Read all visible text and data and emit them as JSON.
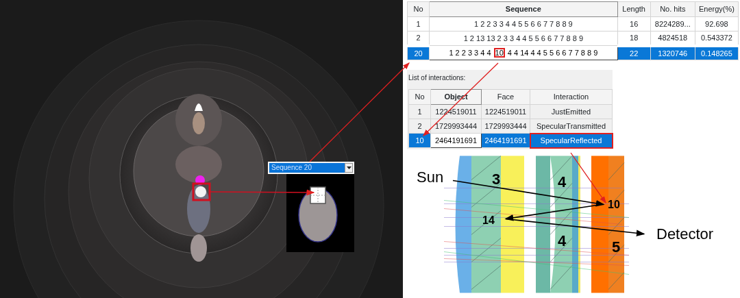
{
  "flare_view": {
    "sequence_dropdown": {
      "value": "Sequence 20"
    }
  },
  "sequences": {
    "columns": [
      {
        "label": "No",
        "sorted": false
      },
      {
        "label": "Sequence",
        "sorted": true
      },
      {
        "label": "Length",
        "sorted": false
      },
      {
        "label": "No. hits",
        "sorted": false
      },
      {
        "label": "Energy(%)",
        "sorted": false
      }
    ],
    "rows": [
      {
        "selected": false,
        "cells": [
          {
            "text": "1"
          },
          {
            "text": "1 2 2 3 3 4 4 5 5 6 6 7 7 8 8 9"
          },
          {
            "text": "16"
          },
          {
            "text": "8224289..."
          },
          {
            "text": "92.698"
          }
        ]
      },
      {
        "selected": false,
        "cells": [
          {
            "text": "2"
          },
          {
            "text": "1 2 13 13 2 3 3 4 4 5 5 6 6 7 7 8 8 9"
          },
          {
            "text": "18"
          },
          {
            "text": "4824518"
          },
          {
            "text": "0.543372"
          }
        ]
      },
      {
        "selected": true,
        "cells": [
          {
            "text": "20",
            "focused": false
          },
          {
            "parts": [
              {
                "text": "1 2 2 3 3 4 4",
                "boxed": false
              },
              {
                "text": "10",
                "boxed": true
              },
              {
                "text": "4 4 14 4 4 5 5 6 6 7 7 8 8 9",
                "boxed": false
              }
            ],
            "focused": true
          },
          {
            "text": "22",
            "focused": false
          },
          {
            "text": "1320746",
            "focused": false
          },
          {
            "text": "0.148265",
            "focused": false
          }
        ]
      }
    ]
  },
  "interactions": {
    "title": "List of interactions:",
    "columns": [
      {
        "label": "No",
        "sorted": false
      },
      {
        "label": "Object",
        "sorted": true
      },
      {
        "label": "Face",
        "sorted": false
      },
      {
        "label": "Interaction",
        "sorted": false
      }
    ],
    "rows": [
      {
        "selected": false,
        "cells": [
          {
            "text": "1"
          },
          {
            "text": "1224519011"
          },
          {
            "text": "1224519011"
          },
          {
            "text": "JustEmitted"
          }
        ]
      },
      {
        "selected": false,
        "cells": [
          {
            "text": "2"
          },
          {
            "text": "1729993444"
          },
          {
            "text": "1729993444"
          },
          {
            "text": "SpecularTransmitted"
          }
        ]
      },
      {
        "selected": true,
        "cells": [
          {
            "text": "10",
            "focused": false,
            "boxed": false
          },
          {
            "text": "2464191691",
            "focused": true,
            "boxed": false
          },
          {
            "text": "2464191691",
            "focused": false,
            "boxed": false
          },
          {
            "text": "SpecularReflected",
            "focused": false,
            "boxed": true
          }
        ]
      }
    ]
  },
  "lens_diagram": {
    "labels": [
      {
        "kind": "plain",
        "text": "Sun"
      },
      {
        "kind": "bold",
        "text": "3"
      },
      {
        "kind": "bold",
        "text": "4"
      },
      {
        "kind": "bold",
        "text": "10"
      },
      {
        "kind": "bold",
        "text": "14"
      },
      {
        "kind": "bold",
        "text": "4"
      },
      {
        "kind": "plain",
        "text": "Detector"
      },
      {
        "kind": "bold",
        "text": "5"
      }
    ]
  }
}
